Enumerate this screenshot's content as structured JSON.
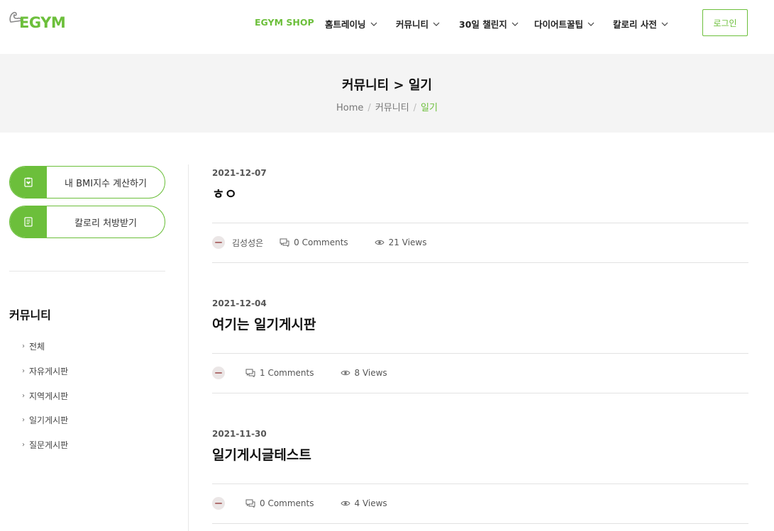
{
  "header": {
    "logo_text": "EGYM",
    "nav": [
      {
        "label": "EGYM SHOP",
        "has_dropdown": false
      },
      {
        "label": "홈트레이닝",
        "has_dropdown": true
      },
      {
        "label": "커뮤니티",
        "has_dropdown": true
      },
      {
        "label": "30일 챌린지",
        "has_dropdown": true
      },
      {
        "label": "다이어트꿀팁",
        "has_dropdown": true
      },
      {
        "label": "칼로리 사전",
        "has_dropdown": true
      }
    ],
    "login_label": "로그인"
  },
  "banner": {
    "title": "커뮤니티 > 일기",
    "breadcrumb": [
      "Home",
      "커뮤니티",
      "일기"
    ]
  },
  "sidebar": {
    "buttons": [
      {
        "label": "내 BMI지수 계산하기",
        "icon": "clipboard-heart-icon"
      },
      {
        "label": "칼로리 처방받기",
        "icon": "document-icon"
      }
    ],
    "heading": "커뮤니티",
    "links": [
      "전체",
      "자유게시판",
      "지역게시판",
      "일기게시판",
      "질문게시판"
    ]
  },
  "posts": [
    {
      "date": "2021-12-07",
      "title": "ㅎㅇ",
      "author": "김성성은",
      "comments": "0 Comments",
      "views": "21 Views"
    },
    {
      "date": "2021-12-04",
      "title": "여기는 일기게시판",
      "author": "",
      "comments": "1 Comments",
      "views": "8 Views"
    },
    {
      "date": "2021-11-30",
      "title": "일기게시글테스트",
      "author": "",
      "comments": "0 Comments",
      "views": "4 Views"
    }
  ],
  "colors": {
    "accent": "#6cbf3b",
    "banner_bg": "#f4f4f4",
    "divider": "#e2e2e2"
  }
}
